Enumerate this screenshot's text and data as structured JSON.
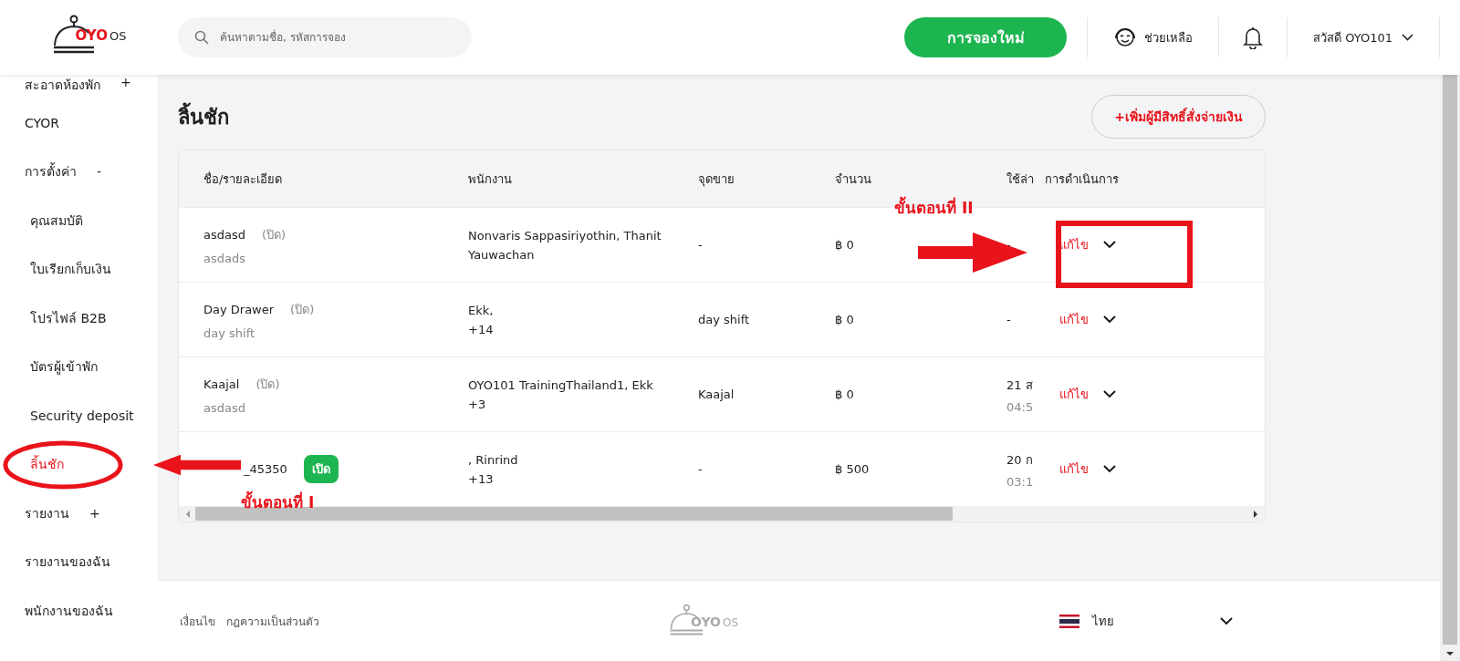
{
  "header": {
    "logo": {
      "brand": "OYO",
      "suffix": "OS"
    },
    "search": {
      "placeholder": "ค้นหาตามชื่อ, รหัสการจอง"
    },
    "new_booking_button": "การจองใหม่",
    "help": "ช่วยเหลือ",
    "greeting": "สวัสดี OYO101"
  },
  "sidebar": {
    "items": [
      {
        "label": "สะอาดห้องพัก",
        "toggle": "+",
        "selected": false
      },
      {
        "label": "CYOR",
        "selected": false
      },
      {
        "label": "การตั้งค่า",
        "toggle": "-",
        "selected": false,
        "children": [
          {
            "label": "คุณสมบัติ",
            "selected": false
          },
          {
            "label": "ใบเรียกเก็บเงิน",
            "selected": false
          },
          {
            "label": "โปรไฟล์ B2B",
            "selected": false
          },
          {
            "label": "บัตรผู้เข้าพัก",
            "selected": false
          },
          {
            "label": "Security deposit",
            "selected": false
          },
          {
            "label": "ลิ้นชัก",
            "selected": true
          }
        ]
      },
      {
        "label": "รายงาน",
        "toggle": "+",
        "selected": false
      },
      {
        "label": "รายงานของฉัน",
        "selected": false
      },
      {
        "label": "พนักงานของฉัน",
        "selected": false
      }
    ]
  },
  "page": {
    "title": "ลิ้นชัก",
    "add_button": "+เพิ่มผู้มีสิทธิ์สั่งจ่ายเงิน"
  },
  "table": {
    "columns": [
      "ชื่อ/รายละเอียด",
      "พนักงาน",
      "จุดขาย",
      "จำนวน",
      "ใช้ล่า",
      "การดำเนินการ"
    ],
    "rows": [
      {
        "name": "asdasd",
        "status": "(ปิด)",
        "open": false,
        "detail": "asdads",
        "staff": [
          "Nonvaris Sappasiriyothin, Thanit",
          "Yauwachan"
        ],
        "point": "-",
        "amount": "฿ 0",
        "last_used": [
          "-"
        ],
        "action": "แก้ไข"
      },
      {
        "name": "Day Drawer",
        "status": "(ปิด)",
        "open": false,
        "detail": "day shift",
        "staff": [
          "Ekk,",
          "+14"
        ],
        "point": "day shift",
        "amount": "฿ 0",
        "last_used": [
          "-"
        ],
        "action": "แก้ไข"
      },
      {
        "name": "Kaajal",
        "status": "(ปิด)",
        "open": false,
        "detail": "asdasd",
        "staff": [
          "OYO101 TrainingThailand1, Ekk",
          "+3"
        ],
        "point": "Kaajal",
        "amount": "฿ 0",
        "last_used": [
          "21 ส",
          "04:5"
        ],
        "action": "แก้ไข"
      },
      {
        "name": "_45350",
        "status": "เปิด",
        "open": true,
        "staff": [
          ", Rinrind",
          "+13"
        ],
        "point": "-",
        "amount": "฿ 500",
        "last_used": [
          "20 ก",
          "03:1"
        ],
        "action": "แก้ไข"
      }
    ]
  },
  "footer": {
    "links": [
      "เงื่อนไข",
      "กฎความเป็นส่วนตัว"
    ],
    "logo": {
      "brand": "OYO",
      "suffix": "OS"
    },
    "language": "ไทย"
  },
  "annotations": [
    {
      "text": "ขั้นตอนที่ I"
    },
    {
      "text": "ขั้นตอนที่ II"
    }
  ]
}
